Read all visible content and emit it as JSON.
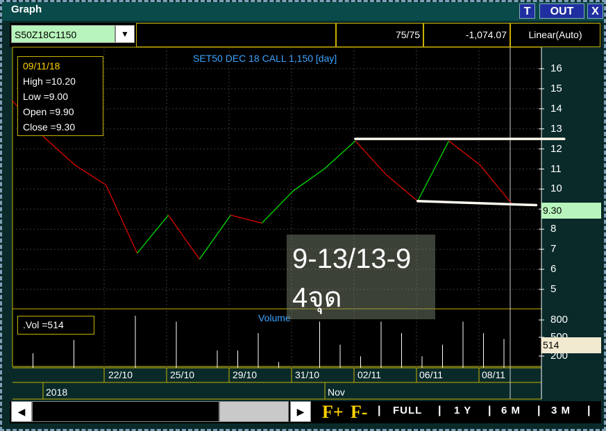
{
  "window": {
    "title": "Graph",
    "buttons": {
      "t": "T",
      "out": "OUT",
      "close": "X"
    }
  },
  "toolbar": {
    "symbol": "S50Z18C1150",
    "dropdown_glyph": "▼",
    "count": "75/75",
    "value": "-1,074.07",
    "scale": "Linear(Auto)"
  },
  "chart": {
    "title": "SET50 DEC 18 CALL 1,150 [day]",
    "volume_title": "Volume",
    "ohlc": {
      "date": "09/11/18",
      "high": "High  =10.20",
      "low": "Low  =9.00",
      "open": "Open  =9.90",
      "close": "Close  =9.30"
    },
    "vol_label": ".Vol  =514",
    "price_tag": "9.30",
    "vol_tag": "514",
    "annotation": {
      "line1": "9-13/13-9",
      "line2": "4จุด"
    },
    "y_ticks": [
      "16",
      "15",
      "14",
      "13",
      "12",
      "11",
      "10",
      "9",
      "8",
      "7",
      "6",
      "5"
    ],
    "vol_ticks": [
      "800",
      "500",
      "200"
    ],
    "date_labels": [
      "22/10",
      "25/10",
      "29/10",
      "31/10",
      "02/11",
      "06/11",
      "08/11"
    ],
    "month_labels": [
      "2018",
      "Nov"
    ],
    "colors": {
      "up": "#00e000",
      "down": "#e00000",
      "grid": "#c8b200",
      "accent": "#3da4ff"
    }
  },
  "chart_data": {
    "type": "line",
    "title": "SET50 DEC 18 CALL 1,150 [day]",
    "price_points": [
      {
        "x": 0,
        "y": 14.4
      },
      {
        "x": 1,
        "y": 12.6
      },
      {
        "x": 2,
        "y": 11.2
      },
      {
        "x": 3,
        "y": 10.2
      },
      {
        "x": 4,
        "y": 6.8
      },
      {
        "x": 5,
        "y": 8.7
      },
      {
        "x": 6,
        "y": 6.5
      },
      {
        "x": 7,
        "y": 8.7
      },
      {
        "x": 8,
        "y": 8.3
      },
      {
        "x": 9,
        "y": 9.9
      },
      {
        "x": 10,
        "y": 11.0
      },
      {
        "x": 11,
        "y": 12.4
      },
      {
        "x": 12,
        "y": 10.7
      },
      {
        "x": 13,
        "y": 9.4
      },
      {
        "x": 14,
        "y": 12.4
      },
      {
        "x": 15,
        "y": 11.2
      },
      {
        "x": 16,
        "y": 9.3
      }
    ],
    "volume": [
      0,
      250,
      0,
      480,
      0,
      0,
      900,
      0,
      800,
      0,
      300,
      300,
      600,
      100,
      0,
      800,
      400,
      200,
      800,
      600,
      200,
      400,
      800,
      600,
      500,
      0
    ],
    "ylim": [
      4.5,
      16.5
    ],
    "trend_lines": [
      {
        "from": [
          11,
          12.5
        ],
        "to": [
          17.7,
          12.5
        ]
      },
      {
        "from": [
          13,
          9.4
        ],
        "to": [
          16.8,
          9.2
        ]
      }
    ],
    "xlabel": "",
    "ylabel": ""
  },
  "bottom": {
    "left_arrow": "◀",
    "right_arrow": "▶",
    "f_plus": "F+",
    "f_minus": "F-",
    "periods": [
      "FULL",
      "1 Y",
      "6 M",
      "3 M"
    ],
    "sep": "|"
  }
}
